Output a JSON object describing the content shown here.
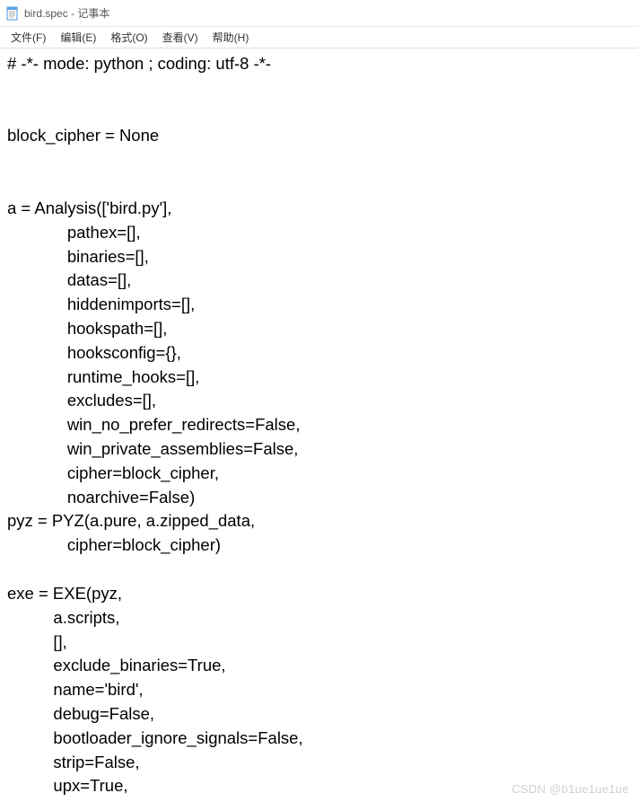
{
  "window": {
    "title": "bird.spec - 记事本"
  },
  "menu": {
    "file": "文件(F)",
    "edit": "编辑(E)",
    "format": "格式(O)",
    "view": "查看(V)",
    "help": "帮助(H)"
  },
  "editor": {
    "content": "# -*- mode: python ; coding: utf-8 -*-\n\n\nblock_cipher = None\n\n\na = Analysis(['bird.py'],\n             pathex=[],\n             binaries=[],\n             datas=[],\n             hiddenimports=[],\n             hookspath=[],\n             hooksconfig={},\n             runtime_hooks=[],\n             excludes=[],\n             win_no_prefer_redirects=False,\n             win_private_assemblies=False,\n             cipher=block_cipher,\n             noarchive=False)\npyz = PYZ(a.pure, a.zipped_data,\n             cipher=block_cipher)\n\nexe = EXE(pyz,\n          a.scripts,\n          [],\n          exclude_binaries=True,\n          name='bird',\n          debug=False,\n          bootloader_ignore_signals=False,\n          strip=False,\n          upx=True,"
  },
  "watermark": "CSDN @b1ue1ue1ue"
}
